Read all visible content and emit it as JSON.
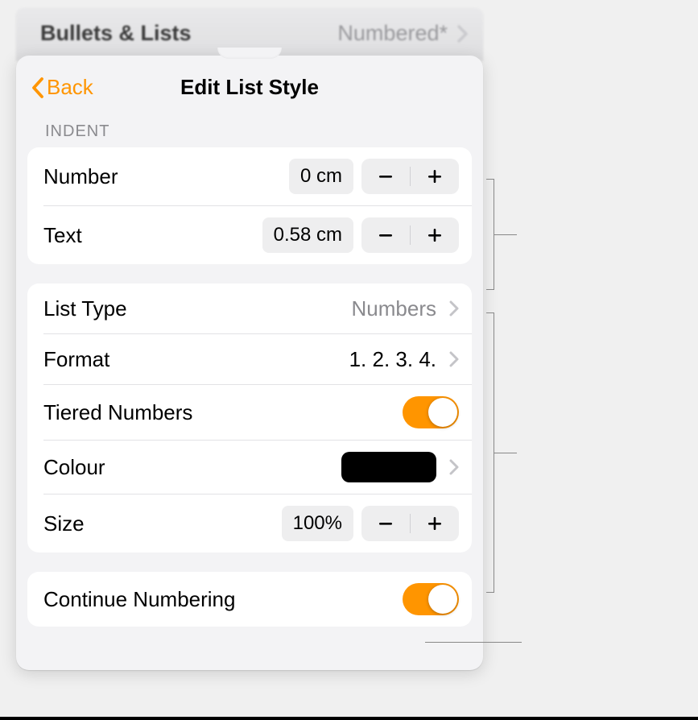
{
  "header": {
    "title": "Bullets & Lists",
    "value": "Numbered*"
  },
  "nav": {
    "back_label": "Back",
    "title": "Edit List Style"
  },
  "sections": {
    "indent": {
      "label": "INDENT",
      "number": {
        "label": "Number",
        "value": "0 cm"
      },
      "text": {
        "label": "Text",
        "value": "0.58 cm"
      }
    },
    "options": {
      "list_type": {
        "label": "List Type",
        "value": "Numbers"
      },
      "format": {
        "label": "Format",
        "value": "1. 2. 3. 4."
      },
      "tiered_numbers": {
        "label": "Tiered Numbers",
        "enabled": true
      },
      "colour": {
        "label": "Colour",
        "value": "#000000"
      },
      "size": {
        "label": "Size",
        "value": "100%"
      }
    },
    "continue_numbering": {
      "label": "Continue Numbering",
      "enabled": true
    }
  }
}
